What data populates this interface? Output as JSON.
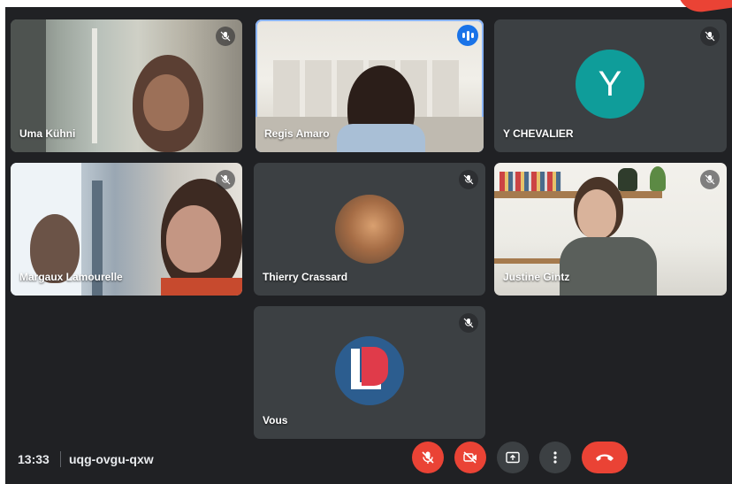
{
  "participants": [
    {
      "name": "Uma Kühni",
      "muted": true
    },
    {
      "name": "Regis Amaro",
      "muted": false,
      "speaking": true
    },
    {
      "name": "Y CHEVALIER",
      "muted": true,
      "avatar_letter": "Y",
      "avatar_color": "#0f9d9a"
    },
    {
      "name": "Margaux Lamourelle",
      "muted": true
    },
    {
      "name": "Thierry Crassard",
      "muted": true
    },
    {
      "name": "Justine Gintz",
      "muted": true
    },
    {
      "name": "Vous",
      "muted": true,
      "logo_text": "LB"
    }
  ],
  "footer": {
    "time": "13:33",
    "meeting_code": "uqg-ovgu-qxw"
  },
  "controls": {
    "mic": "mic-off-icon",
    "camera": "camera-off-icon",
    "present": "present-screen-icon",
    "more": "more-vert-icon",
    "leave": "call-end-icon"
  },
  "colors": {
    "background": "#202124",
    "tile": "#3c4043",
    "danger": "#ea4335",
    "accent": "#1a73e8"
  }
}
